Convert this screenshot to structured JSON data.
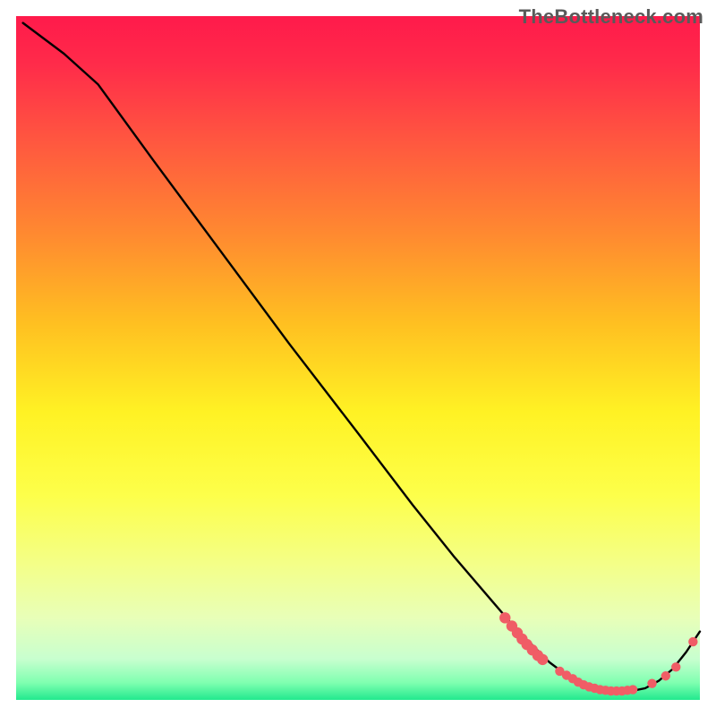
{
  "watermark": "TheBottleneck.com",
  "chart_data": {
    "type": "line",
    "title": "",
    "xlabel": "",
    "ylabel": "",
    "xlim": [
      0,
      100
    ],
    "ylim": [
      0,
      100
    ],
    "gradient_stops": [
      {
        "offset": 0,
        "color": "#ff1a4b"
      },
      {
        "offset": 0.07,
        "color": "#ff2b4a"
      },
      {
        "offset": 0.18,
        "color": "#ff5640"
      },
      {
        "offset": 0.32,
        "color": "#ff8a30"
      },
      {
        "offset": 0.45,
        "color": "#ffc021"
      },
      {
        "offset": 0.58,
        "color": "#fff224"
      },
      {
        "offset": 0.7,
        "color": "#fdff4a"
      },
      {
        "offset": 0.8,
        "color": "#f4ff87"
      },
      {
        "offset": 0.88,
        "color": "#e8ffb8"
      },
      {
        "offset": 0.94,
        "color": "#c8ffcf"
      },
      {
        "offset": 0.975,
        "color": "#7fffb0"
      },
      {
        "offset": 1.0,
        "color": "#22e98e"
      }
    ],
    "series": [
      {
        "name": "curve",
        "color": "#000000",
        "x": [
          1,
          7,
          12,
          20,
          30,
          40,
          50,
          58,
          64,
          70,
          73,
          76,
          78,
          80,
          82,
          84,
          86,
          88,
          90,
          92,
          94,
          96,
          98,
          100
        ],
        "y": [
          99,
          94.5,
          90,
          79,
          65.5,
          52,
          39,
          28.5,
          21,
          14,
          10.5,
          7.5,
          5.5,
          4,
          3,
          2.2,
          1.6,
          1.3,
          1.3,
          1.7,
          2.8,
          4.5,
          7,
          10
        ]
      }
    ],
    "markers": {
      "color": "#f05d66",
      "radius_small": 5.2,
      "radius_large": 6.2,
      "points": [
        {
          "x": 71.5,
          "y": 12.0,
          "r": "large"
        },
        {
          "x": 72.5,
          "y": 10.8,
          "r": "large"
        },
        {
          "x": 73.3,
          "y": 9.8,
          "r": "large"
        },
        {
          "x": 74.0,
          "y": 8.9,
          "r": "large"
        },
        {
          "x": 74.7,
          "y": 8.1,
          "r": "large"
        },
        {
          "x": 75.5,
          "y": 7.3,
          "r": "large"
        },
        {
          "x": 76.3,
          "y": 6.5,
          "r": "large"
        },
        {
          "x": 77.0,
          "y": 5.9,
          "r": "large"
        },
        {
          "x": 79.5,
          "y": 4.2,
          "r": "small"
        },
        {
          "x": 80.5,
          "y": 3.6,
          "r": "small"
        },
        {
          "x": 81.4,
          "y": 3.1,
          "r": "small"
        },
        {
          "x": 82.2,
          "y": 2.6,
          "r": "small"
        },
        {
          "x": 83.0,
          "y": 2.2,
          "r": "small"
        },
        {
          "x": 83.8,
          "y": 1.9,
          "r": "small"
        },
        {
          "x": 84.6,
          "y": 1.7,
          "r": "small"
        },
        {
          "x": 85.4,
          "y": 1.5,
          "r": "small"
        },
        {
          "x": 86.2,
          "y": 1.4,
          "r": "small"
        },
        {
          "x": 87.0,
          "y": 1.3,
          "r": "small"
        },
        {
          "x": 87.8,
          "y": 1.3,
          "r": "small"
        },
        {
          "x": 88.6,
          "y": 1.3,
          "r": "small"
        },
        {
          "x": 89.4,
          "y": 1.4,
          "r": "small"
        },
        {
          "x": 90.2,
          "y": 1.5,
          "r": "small"
        },
        {
          "x": 93.0,
          "y": 2.4,
          "r": "small"
        },
        {
          "x": 95.0,
          "y": 3.5,
          "r": "small"
        },
        {
          "x": 96.5,
          "y": 4.8,
          "r": "small"
        },
        {
          "x": 99.0,
          "y": 8.5,
          "r": "small"
        }
      ]
    }
  }
}
